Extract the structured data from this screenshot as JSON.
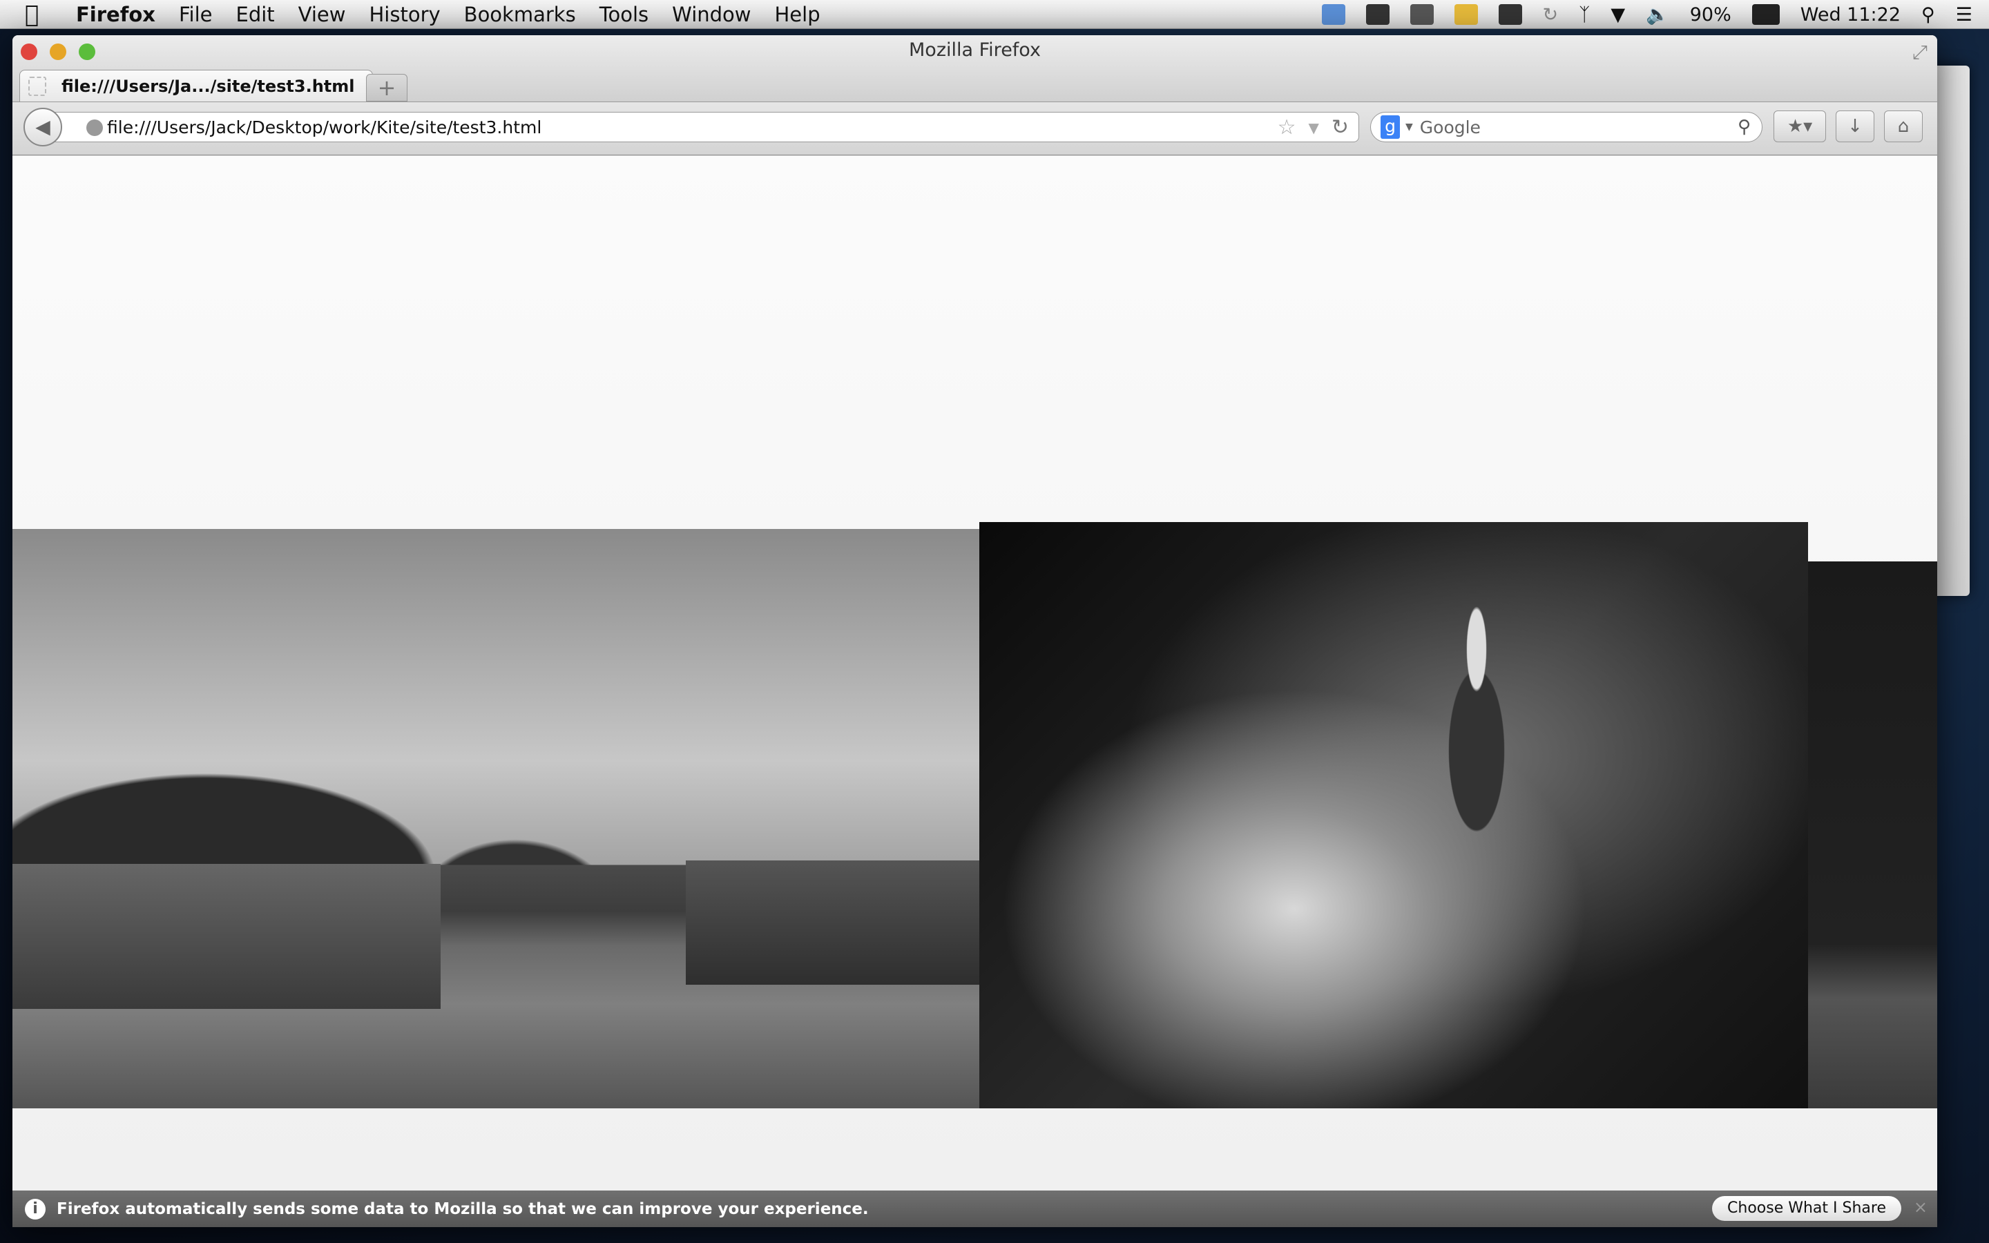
{
  "menubar": {
    "app": "Firefox",
    "items": [
      "File",
      "Edit",
      "View",
      "History",
      "Bookmarks",
      "Tools",
      "Window",
      "Help"
    ],
    "status": {
      "battery": "90%",
      "clock": "Wed 11:22"
    }
  },
  "window": {
    "title": "Mozilla Firefox"
  },
  "tab": {
    "label": "file:///Users/Ja.../site/test3.html",
    "new_tab": "+"
  },
  "toolbar": {
    "url": "file:///Users/Jack/Desktop/work/Kite/site/test3.html",
    "search_placeholder": "Google",
    "search_engine": "g"
  },
  "notification": {
    "message": "Firefox automatically sends some data to Mozilla so that we can improve your experience.",
    "button": "Choose What I Share",
    "close": "×",
    "info_icon": "i"
  },
  "colors": {
    "search_engine_badge": "#3b82f6",
    "close_light": "#e0443e",
    "minimize_light": "#e6a526",
    "zoom_light": "#5bbd3c"
  }
}
